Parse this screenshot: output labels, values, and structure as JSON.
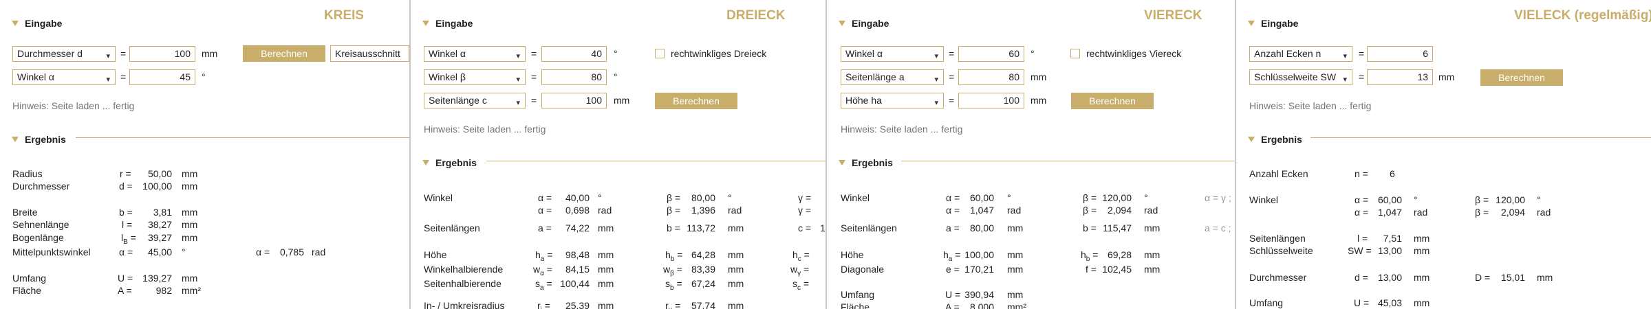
{
  "section_input": "Eingabe",
  "section_result": "Ergebnis",
  "unit_mm": "mm",
  "unit_deg": "°",
  "unit_rad": "rad",
  "eq": "=",
  "kreis": {
    "title": "KREIS",
    "sel1": "Durchmesser d",
    "val1": "100",
    "sel2": "Winkel α",
    "val2": "45",
    "btn": "Berechnen",
    "btn2": "Kreisausschnitt",
    "hint": "Hinweis: Seite laden ... fertig",
    "res": {
      "radius": {
        "label": "Radius",
        "sym": "r =",
        "val": "50,00"
      },
      "diam": {
        "label": "Durchmesser",
        "sym": "d =",
        "val": "100,00"
      },
      "breite": {
        "label": "Breite",
        "sym": "b =",
        "val": "3,81"
      },
      "sehne": {
        "label": "Sehnenlänge",
        "sym": "l =",
        "val": "38,27"
      },
      "bogen": {
        "label": "Bogenlänge",
        "sym": "l",
        "sub": "B",
        "symeq": " =",
        "val": "39,27"
      },
      "mpw": {
        "label": "Mittelpunktswinkel",
        "sym": "α =",
        "val": "45,00",
        "sym2": "α =",
        "val2": "0,785"
      },
      "umfang": {
        "label": "Umfang",
        "sym": "U =",
        "val": "139,27"
      },
      "flaeche": {
        "label": "Fläche",
        "sym": "A =",
        "val": "982",
        "unit": "mm²"
      }
    }
  },
  "dreieck": {
    "title": "DREIECK",
    "sel1": "Winkel α",
    "val1": "40",
    "sel2": "Winkel β",
    "val2": "80",
    "sel3": "Seitenlänge c",
    "val3": "100",
    "check": "rechtwinkliges Dreieck",
    "btn": "Berechnen",
    "hint": "Hinweis: Seite laden ... fertig",
    "res": {
      "winkel": "Winkel",
      "a1s": "α =",
      "a1v": "40,00",
      "b1s": "β =",
      "b1v": "80,00",
      "g1s": "γ =",
      "a2s": "α =",
      "a2v": "0,698",
      "b2s": "β =",
      "b2v": "1,396",
      "g2s": "γ =",
      "seiten": "Seitenlängen",
      "sas": "a =",
      "sav": "74,22",
      "sbs": "b =",
      "sbv": "113,72",
      "scs": "c =",
      "scv": "1",
      "hoehe": "Höhe",
      "ha": "h",
      "ha_sub": "a",
      "hav": "98,48",
      "hb": "h",
      "hb_sub": "b",
      "hbv": "64,28",
      "hc": "h",
      "hc_sub": "c",
      "wh": "Winkelhalbierende",
      "wa": "w",
      "wa_sub": "α",
      "wav": "84,15",
      "wb": "w",
      "wb_sub": "β",
      "wbv": "83,39",
      "wg": "w",
      "wg_sub": "γ",
      "sh": "Seitenhalbierende",
      "sa": "s",
      "sa_sub": "a",
      "sav2": "100,44",
      "sb": "s",
      "sb_sub": "b",
      "sbv2": "67,24",
      "sc": "s",
      "sc_sub": "c",
      "iu": "In- / Umkreisradius",
      "ri": "r",
      "ri_sub": "i",
      "riv": "25,39",
      "ru": "r",
      "ru_sub": "u",
      "ruv": "57,74"
    }
  },
  "viereck": {
    "title": "VIERECK",
    "sel1": "Winkel α",
    "val1": "60",
    "sel2": "Seitenlänge a",
    "val2": "80",
    "sel3": "Höhe ha",
    "val3": "100",
    "check": "rechtwinkliges Viereck",
    "btn": "Berechnen",
    "hint": "Hinweis: Seite laden ... fertig",
    "res": {
      "winkel": "Winkel",
      "a1s": "α =",
      "a1v": "60,00",
      "b1s": "β =",
      "b1v": "120,00",
      "g1": "α = γ ;",
      "a2s": "α =",
      "a2v": "1,047",
      "b2s": "β =",
      "b2v": "2,094",
      "seiten": "Seitenlängen",
      "sas": "a =",
      "sav": "80,00",
      "sbs": "b =",
      "sbv": "115,47",
      "sc": "a = c ;",
      "hoehe": "Höhe",
      "ha": "h",
      "ha_sub": "a",
      "hav": "100,00",
      "hb": "h",
      "hb_sub": "b",
      "hbv": "69,28",
      "diag": "Diagonale",
      "es": "e =",
      "ev": "170,21",
      "fs": "f =",
      "fv": "102,45",
      "umfang": "Umfang",
      "us": "U =",
      "uv": "390,94",
      "flaeche": "Fläche",
      "fls": "A =",
      "flv": "8,000",
      "flu": "mm²"
    }
  },
  "vieleck": {
    "title": "VIELECK (regelmäßig)",
    "sel1": "Anzahl Ecken n",
    "val1": "6",
    "sel2": "Schlüsselweite SW",
    "val2": "13",
    "btn": "Berechnen",
    "hint": "Hinweis: Seite laden ... fertig",
    "res": {
      "ecken": "Anzahl Ecken",
      "ns": "n =",
      "nv": "6",
      "winkel": "Winkel",
      "a1s": "α =",
      "a1v": "60,00",
      "b1s": "β =",
      "b1v": "120,00",
      "a2s": "α =",
      "a2v": "1,047",
      "b2s": "β =",
      "b2v": "2,094",
      "seiten": "Seitenlängen",
      "ls": "l =",
      "lv": "7,51",
      "sw": "Schlüsselweite",
      "sws": "SW =",
      "swv": "13,00",
      "durch": "Durchmesser",
      "ds": "d =",
      "dv": "13,00",
      "Ds": "D =",
      "Dv": "15,01",
      "umfang": "Umfang",
      "us": "U =",
      "uv": "45,03"
    }
  }
}
